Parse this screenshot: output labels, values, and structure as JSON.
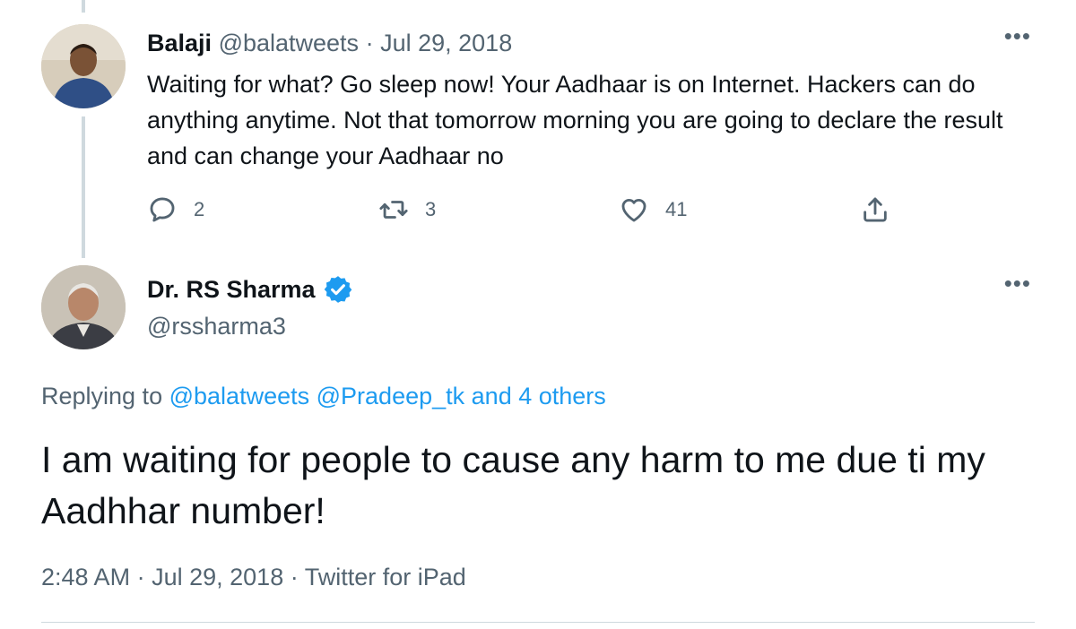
{
  "parent_tweet": {
    "author_name": "Balaji",
    "handle": "@balatweets",
    "separator": "·",
    "date": "Jul 29, 2018",
    "text": "Waiting for what? Go sleep now! Your Aadhaar is on Internet. Hackers can do anything anytime. Not that tomorrow morning you are going to declare the result and can change your Aadhaar no",
    "more_label": "•••",
    "actions": {
      "reply_count": "2",
      "retweet_count": "3",
      "like_count": "41"
    },
    "icons": [
      "reply-icon",
      "retweet-icon",
      "like-icon",
      "share-icon"
    ]
  },
  "main_tweet": {
    "author_name": "Dr. RS Sharma",
    "handle": "@rssharma3",
    "verified": true,
    "more_label": "•••",
    "replying_prefix": "Replying to",
    "replying_to": [
      "@balatweets",
      "@Pradeep_tk"
    ],
    "replying_others": "and 4 others",
    "text": "I am waiting for people to cause any harm to me due ti my Aadhhar number!",
    "time": "2:48 AM",
    "separator": "·",
    "date": "Jul 29, 2018",
    "source": "Twitter for iPad"
  },
  "colors": {
    "accent": "#1d9bf0",
    "muted": "#536471",
    "text": "#0f1419",
    "divider": "#cfd9de"
  }
}
